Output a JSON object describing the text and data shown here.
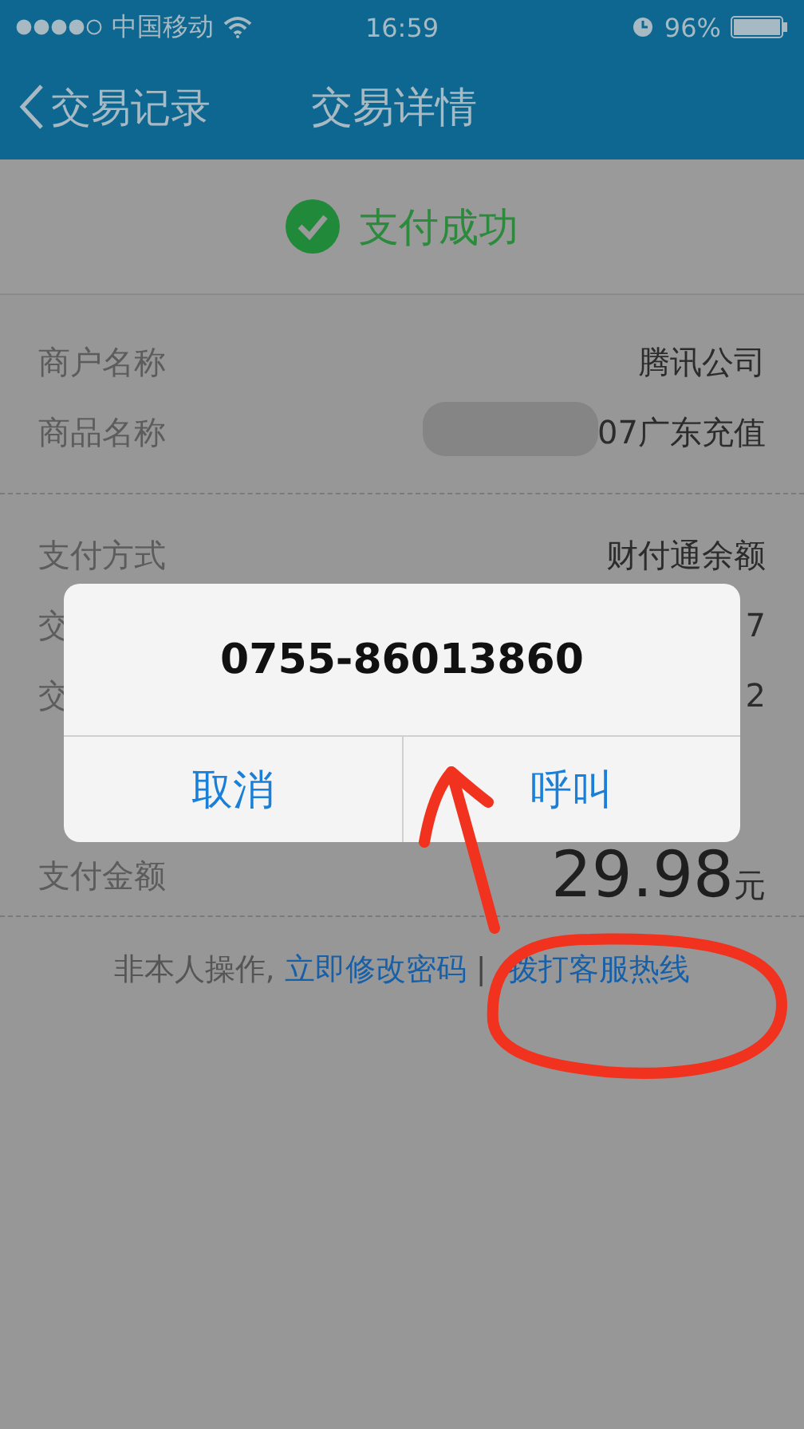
{
  "status_bar": {
    "carrier": "中国移动",
    "time": "16:59",
    "battery": "96%"
  },
  "nav": {
    "back": "交易记录",
    "title": "交易详情"
  },
  "result": {
    "text": "支付成功"
  },
  "detail_groups": [
    [
      {
        "label": "商户名称",
        "value": "腾讯公司",
        "redacted": false
      },
      {
        "label": "商品名称",
        "value": "07广东充值",
        "redacted": true
      }
    ],
    [
      {
        "label": "支付方式",
        "value": "财付通余额",
        "redacted": false
      },
      {
        "label": "交",
        "value": "7"
      },
      {
        "label": "交",
        "value": "2"
      }
    ]
  ],
  "amount": {
    "label": "支付金额",
    "value": "29.98",
    "unit": "元"
  },
  "footer": {
    "note": "非本人操作,",
    "links": [
      "立即修改密码",
      "拨打客服热线"
    ],
    "separator": "|"
  },
  "dialog": {
    "title": "0755-86013860",
    "buttons": [
      "取消",
      "呼叫"
    ]
  }
}
